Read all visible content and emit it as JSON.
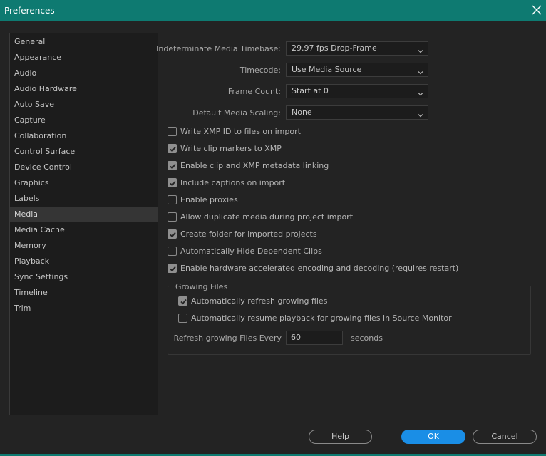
{
  "window": {
    "title": "Preferences"
  },
  "sidebar": {
    "items": [
      {
        "label": "General"
      },
      {
        "label": "Appearance"
      },
      {
        "label": "Audio"
      },
      {
        "label": "Audio Hardware"
      },
      {
        "label": "Auto Save"
      },
      {
        "label": "Capture"
      },
      {
        "label": "Collaboration"
      },
      {
        "label": "Control Surface"
      },
      {
        "label": "Device Control"
      },
      {
        "label": "Graphics"
      },
      {
        "label": "Labels"
      },
      {
        "label": "Media"
      },
      {
        "label": "Media Cache"
      },
      {
        "label": "Memory"
      },
      {
        "label": "Playback"
      },
      {
        "label": "Sync Settings"
      },
      {
        "label": "Timeline"
      },
      {
        "label": "Trim"
      }
    ],
    "selected": "Media"
  },
  "media": {
    "timebase": {
      "label": "Indeterminate Media Timebase:",
      "value": "29.97 fps Drop-Frame"
    },
    "timecode": {
      "label": "Timecode:",
      "value": "Use Media Source"
    },
    "frame_count": {
      "label": "Frame Count:",
      "value": "Start at 0"
    },
    "scaling": {
      "label": "Default Media Scaling:",
      "value": "None"
    },
    "checkboxes": [
      {
        "label": "Write XMP ID to files on import",
        "checked": false
      },
      {
        "label": "Write clip markers to XMP",
        "checked": true
      },
      {
        "label": "Enable clip and XMP metadata linking",
        "checked": true
      },
      {
        "label": "Include captions on import",
        "checked": true
      },
      {
        "label": "Enable proxies",
        "checked": false
      },
      {
        "label": "Allow duplicate media during project import",
        "checked": false
      },
      {
        "label": "Create folder for imported projects",
        "checked": true
      },
      {
        "label": "Automatically Hide Dependent Clips",
        "checked": false
      },
      {
        "label": "Enable hardware accelerated encoding and decoding (requires restart)",
        "checked": true
      }
    ]
  },
  "growing_files": {
    "title": "Growing Files",
    "checkboxes": [
      {
        "label": "Automatically refresh growing files",
        "checked": true
      },
      {
        "label": "Automatically resume playback for growing files in Source Monitor",
        "checked": false
      }
    ],
    "refresh_label": "Refresh growing Files Every",
    "refresh_value": "60",
    "refresh_unit": "seconds"
  },
  "buttons": {
    "help": "Help",
    "ok": "OK",
    "cancel": "Cancel"
  },
  "colors": {
    "titlebar": "#0e7a71",
    "accent": "#1a8ee6",
    "background": "#232323"
  },
  "icons": {
    "close": "close-icon",
    "dropdown": "chevron-down-icon",
    "check": "checkmark-icon"
  }
}
